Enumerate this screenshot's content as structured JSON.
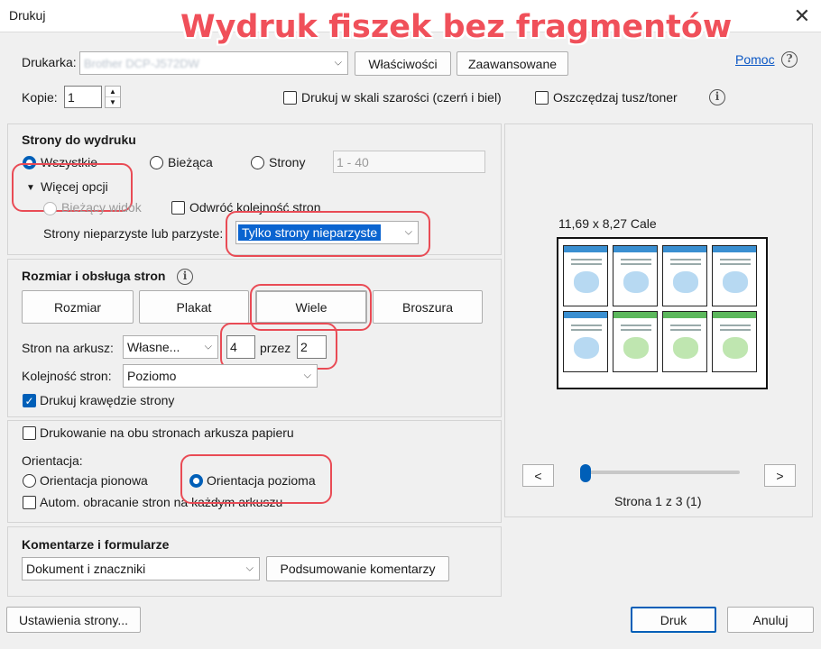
{
  "window": {
    "title": "Drukuj",
    "overlay_title": "Wydruk fiszek bez fragmentów"
  },
  "top": {
    "printer_label": "Drukarka:",
    "printer_value": "Brother DCP-J572DW",
    "properties_button": "Właściwości",
    "advanced_button": "Zaawansowane",
    "help_link": "Pomoc",
    "copies_label": "Kopie:",
    "copies_value": "1",
    "grayscale_label": "Drukuj w skali szarości (czerń i biel)",
    "save_ink_label": "Oszczędzaj tusz/toner"
  },
  "pages_section": {
    "heading": "Strony do wydruku",
    "all_label": "Wszystkie",
    "current_label": "Bieżąca",
    "pages_label": "Strony",
    "pages_range": "1 - 40",
    "more_options_label": "Więcej opcji",
    "current_view_label": "Bieżący widok",
    "reverse_label": "Odwróć kolejność stron",
    "odd_even_label": "Strony nieparzyste lub parzyste:",
    "odd_even_value": "Tylko strony nieparzyste"
  },
  "sizing_section": {
    "heading": "Rozmiar i obsługa stron",
    "tabs": [
      "Rozmiar",
      "Plakat",
      "Wiele",
      "Broszura"
    ],
    "pages_per_sheet_label": "Stron na arkusz:",
    "pages_per_sheet_value": "Własne...",
    "cols_value": "4",
    "by_label": "przez",
    "rows_value": "2",
    "page_order_label": "Kolejność stron:",
    "page_order_value": "Poziomo",
    "print_borders_label": "Drukuj krawędzie strony"
  },
  "orientation_section": {
    "duplex_label": "Drukowanie na obu stronach arkusza papieru",
    "orientation_label": "Orientacja:",
    "portrait_label": "Orientacja pionowa",
    "landscape_label": "Orientacja pozioma",
    "auto_rotate_label": "Autom. obracanie stron na każdym arkuszu"
  },
  "comments_section": {
    "heading": "Komentarze i formularze",
    "value": "Dokument i znaczniki",
    "summary_button": "Podsumowanie komentarzy"
  },
  "preview": {
    "size_label": "11,69 x 8,27 Cale",
    "prev_button": "<",
    "next_button": ">",
    "page_status": "Strona 1 z 3 (1)",
    "slider_position": 0
  },
  "footer": {
    "page_setup_button": "Ustawienia strony...",
    "print_button": "Druk",
    "cancel_button": "Anuluj"
  },
  "colors": {
    "accent": "#005fb8",
    "highlight": "#e94b55"
  }
}
